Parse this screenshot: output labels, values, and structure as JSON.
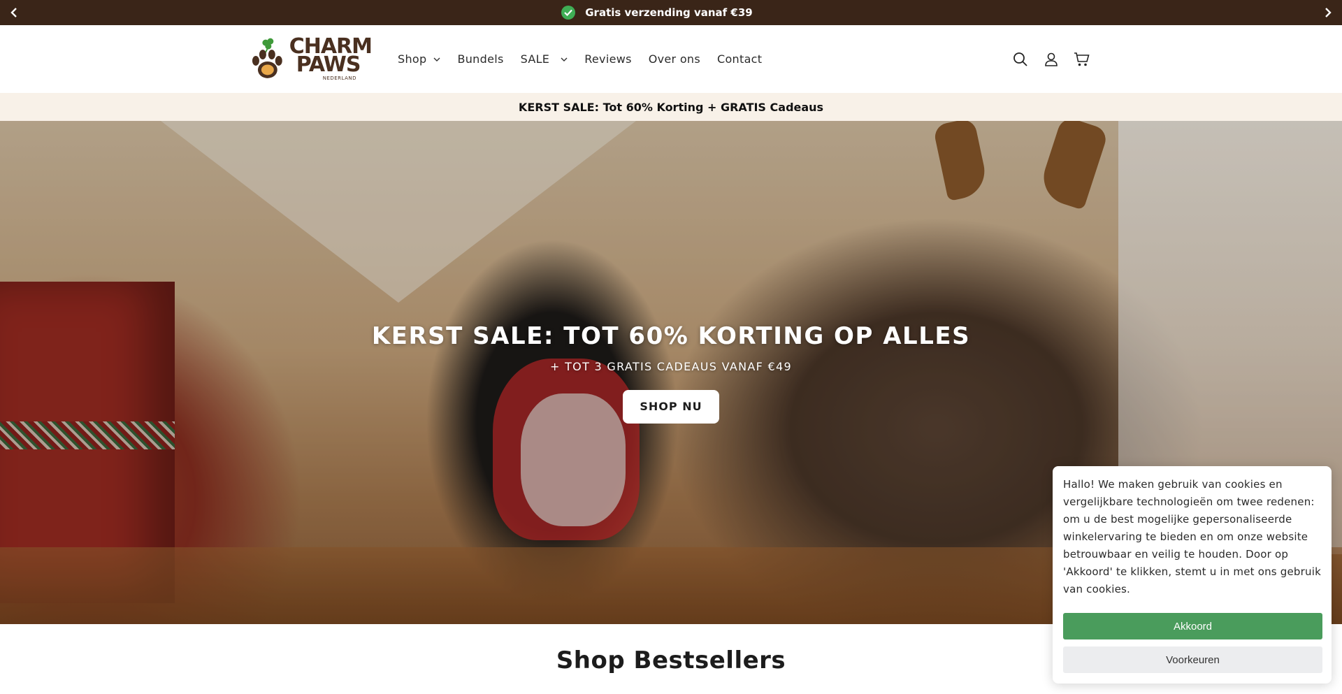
{
  "announcement": {
    "text": "Gratis verzending vanaf €39",
    "prev_icon": "chevron-left-icon",
    "next_icon": "chevron-right-icon",
    "check_icon": "check-circle-icon"
  },
  "header": {
    "logo": {
      "line1": "CHARM",
      "line2": "PAWS",
      "sub": "NEDERLAND"
    },
    "nav": [
      {
        "label": "Shop",
        "has_dropdown": true
      },
      {
        "label": "Bundels",
        "has_dropdown": false
      },
      {
        "label": "SALE",
        "has_dropdown": true
      },
      {
        "label": "Reviews",
        "has_dropdown": false
      },
      {
        "label": "Over ons",
        "has_dropdown": false
      },
      {
        "label": "Contact",
        "has_dropdown": false
      }
    ],
    "icons": [
      "search-icon",
      "account-icon",
      "cart-icon"
    ]
  },
  "promo": {
    "text": "KERST SALE: Tot 60% Korting + GRATIS Cadeaus"
  },
  "hero": {
    "title": "KERST SALE: TOT 60% KORTING OP ALLES",
    "subtitle": "+ TOT 3 GRATIS CADEAUS VANAF €49",
    "button": "SHOP NU"
  },
  "section": {
    "title": "Shop Bestsellers"
  },
  "cookie": {
    "text": "Hallo! We maken gebruik van cookies en vergelijkbare technologieën om twee redenen: om u de best mogelijke gepersonaliseerde winkelervaring te bieden en om onze website betrouwbaar en veilig te houden. Door op 'Akkoord' te klikken, stemt u in met ons gebruik van cookies.",
    "accept": "Akkoord",
    "preferences": "Voorkeuren"
  },
  "colors": {
    "announce_bg": "#3a2518",
    "promo_bg": "#f8f1e8",
    "accept_green": "#4a9c5c",
    "brand_brown": "#4a3020",
    "clover_green": "#3f9a3a"
  }
}
